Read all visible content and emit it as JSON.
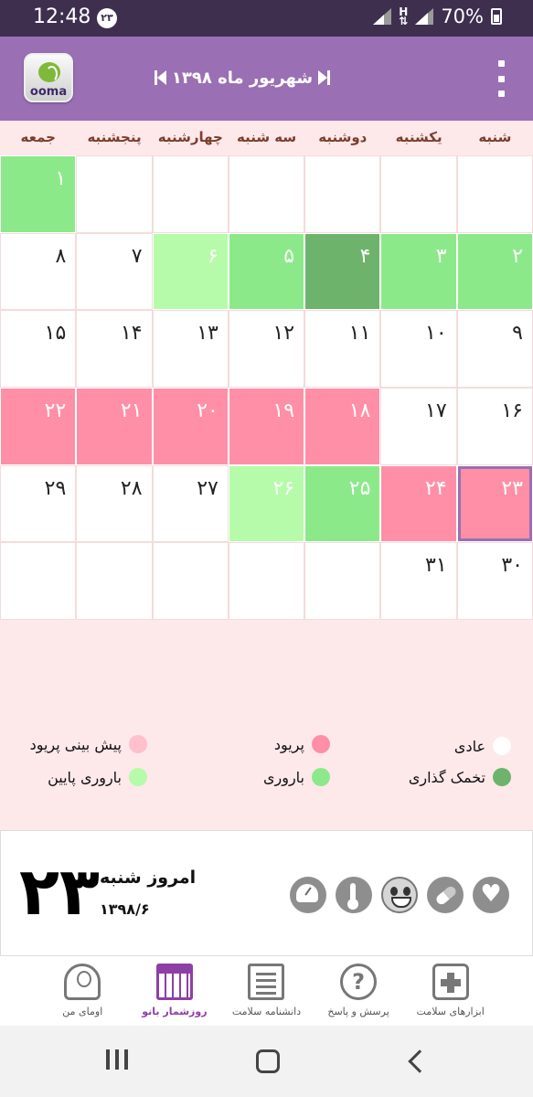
{
  "status_bar": {
    "time": "12:48",
    "notification_badge": "۲۳",
    "battery_percent": "70%"
  },
  "app_bar": {
    "logo_text": "ooma",
    "month_title": "شهریور ماه ۱۳۹۸"
  },
  "weekdays": [
    "شنبه",
    "یکشنبه",
    "دوشنبه",
    "سه شنبه",
    "چهارشنبه",
    "پنجشنبه",
    "جمعه"
  ],
  "calendar": {
    "rows": [
      [
        {
          "d": "",
          "t": "empty"
        },
        {
          "d": "",
          "t": "empty"
        },
        {
          "d": "",
          "t": "empty"
        },
        {
          "d": "",
          "t": "empty"
        },
        {
          "d": "",
          "t": "empty"
        },
        {
          "d": "",
          "t": "empty"
        },
        {
          "d": "۱",
          "t": "fertile"
        }
      ],
      [
        {
          "d": "۲",
          "t": "fertile"
        },
        {
          "d": "۳",
          "t": "fertile"
        },
        {
          "d": "۴",
          "t": "ovulation"
        },
        {
          "d": "۵",
          "t": "fertile"
        },
        {
          "d": "۶",
          "t": "lowfert"
        },
        {
          "d": "۷",
          "t": "normal"
        },
        {
          "d": "۸",
          "t": "normal"
        }
      ],
      [
        {
          "d": "۹",
          "t": "normal"
        },
        {
          "d": "۱۰",
          "t": "normal"
        },
        {
          "d": "۱۱",
          "t": "normal"
        },
        {
          "d": "۱۲",
          "t": "normal"
        },
        {
          "d": "۱۳",
          "t": "normal"
        },
        {
          "d": "۱۴",
          "t": "normal"
        },
        {
          "d": "۱۵",
          "t": "normal"
        }
      ],
      [
        {
          "d": "۱۶",
          "t": "normal"
        },
        {
          "d": "۱۷",
          "t": "normal"
        },
        {
          "d": "۱۸",
          "t": "period"
        },
        {
          "d": "۱۹",
          "t": "period"
        },
        {
          "d": "۲۰",
          "t": "period"
        },
        {
          "d": "۲۱",
          "t": "period"
        },
        {
          "d": "۲۲",
          "t": "period"
        }
      ],
      [
        {
          "d": "۲۳",
          "t": "period today"
        },
        {
          "d": "۲۴",
          "t": "period"
        },
        {
          "d": "۲۵",
          "t": "fertile"
        },
        {
          "d": "۲۶",
          "t": "lowfert"
        },
        {
          "d": "۲۷",
          "t": "normal"
        },
        {
          "d": "۲۸",
          "t": "normal"
        },
        {
          "d": "۲۹",
          "t": "normal"
        }
      ],
      [
        {
          "d": "۳۰",
          "t": "normal"
        },
        {
          "d": "۳۱",
          "t": "normal"
        },
        {
          "d": "",
          "t": "empty"
        },
        {
          "d": "",
          "t": "empty"
        },
        {
          "d": "",
          "t": "empty"
        },
        {
          "d": "",
          "t": "empty"
        },
        {
          "d": "",
          "t": "empty"
        }
      ]
    ]
  },
  "legend": {
    "normal": {
      "label": "عادی",
      "color": "#ffffff"
    },
    "period": {
      "label": "پریود",
      "color": "#ff8fa7"
    },
    "predict": {
      "label": "پیش بینی پریود",
      "color": "#ffc0cb"
    },
    "ovulation": {
      "label": "تخمک گذاری",
      "color": "#6db36b"
    },
    "fertile": {
      "label": "باروری",
      "color": "#8ce98a"
    },
    "lowfert": {
      "label": "باروری پایین",
      "color": "#b6fbaa"
    }
  },
  "today": {
    "big_number": "۲۳",
    "label": "امروز شنبه",
    "date": "۱۳۹۸/۶"
  },
  "bottom_nav": [
    {
      "label": "ابزارهای سلامت",
      "icon": "medical-kit-icon",
      "active": false
    },
    {
      "label": "پرسش و پاسخ",
      "icon": "question-bubble-icon",
      "active": false
    },
    {
      "label": "دانشنامه سلامت",
      "icon": "newspaper-icon",
      "active": false
    },
    {
      "label": "روزشمار بانو",
      "icon": "calendar-icon",
      "active": true
    },
    {
      "label": "اومای من",
      "icon": "user-icon",
      "active": false
    }
  ]
}
